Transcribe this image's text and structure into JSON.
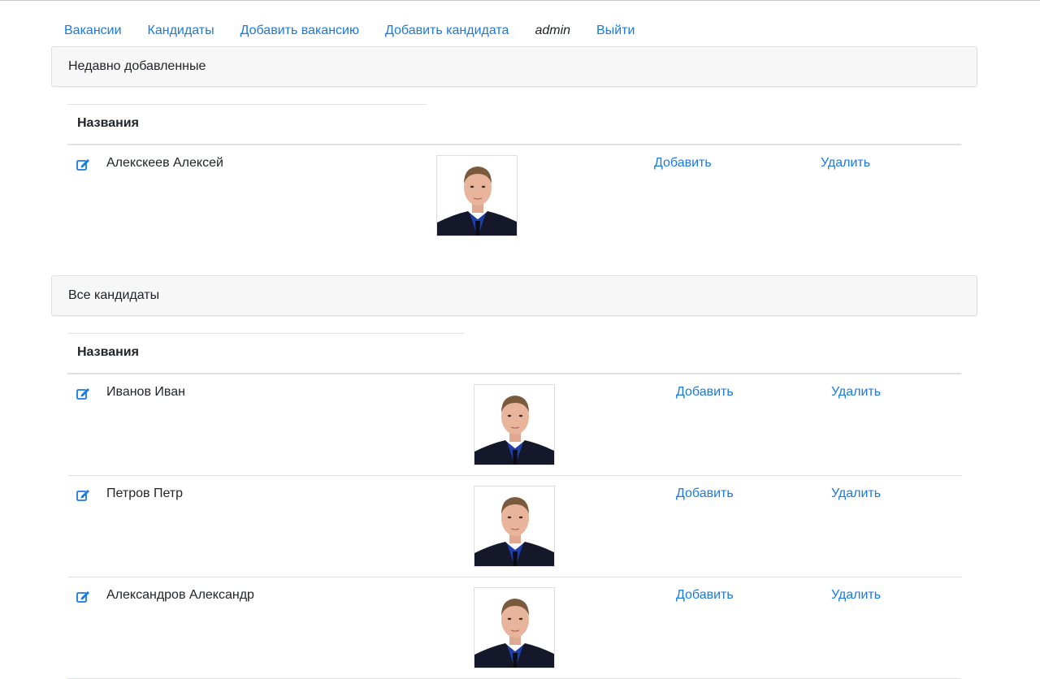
{
  "nav": {
    "vacancies": "Вакансии",
    "candidates": "Кандидаты",
    "add_vacancy": "Добавить вакансию",
    "add_candidate": "Добавить кандидата",
    "user": "admin",
    "logout": "Выйти"
  },
  "recent": {
    "header": "Недавно добавленные",
    "column_header": "Названия",
    "rows": [
      {
        "name": "Алекскеев Алексей",
        "add": "Добавить",
        "delete": "Удалить"
      }
    ]
  },
  "all": {
    "header": "Все кандидаты",
    "column_header": "Названия",
    "rows": [
      {
        "name": "Иванов Иван",
        "add": "Добавить",
        "delete": "Удалить"
      },
      {
        "name": "Петров Петр",
        "add": "Добавить",
        "delete": "Удалить"
      },
      {
        "name": "Александров Александр",
        "add": "Добавить",
        "delete": "Удалить"
      }
    ]
  },
  "icons": {
    "edit": "edit-icon",
    "photo": "candidate-photo"
  },
  "colors": {
    "link": "#1a7ae0",
    "header_bg": "#f7f7f7",
    "border": "#dee2e6"
  }
}
